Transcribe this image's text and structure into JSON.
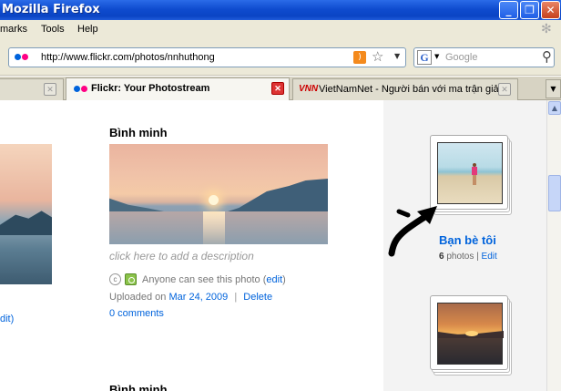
{
  "window": {
    "title": "Mozilla Firefox"
  },
  "menu": {
    "bookmarks": "marks",
    "tools": "Tools",
    "help": "Help"
  },
  "nav": {
    "url": "http://www.flickr.com/photos/nnhuthong",
    "search_placeholder": "Google",
    "search_engine_letter": "G"
  },
  "tabs": [
    {
      "label": ""
    },
    {
      "label": "Flickr: Your Photostream"
    },
    {
      "label": "VietNamNet - Người bán với ma trận giả...",
      "icon_text": "VNN"
    }
  ],
  "left_partial": {
    "link": "dit)"
  },
  "photo": {
    "title": "Bình minh",
    "description_placeholder": "click here to add a description",
    "permission": "Anyone can see this photo",
    "edit": "edit",
    "uploaded_label": "Uploaded on",
    "uploaded_date": "Mar 24, 2009",
    "delete": "Delete",
    "comments": "0 comments"
  },
  "photo2": {
    "title": "Bình minh"
  },
  "set": {
    "title": "Bạn bè tôi",
    "count": "6",
    "count_label": "photos",
    "edit": "Edit"
  },
  "icons": {
    "favicon": "flickr-favicon",
    "rss": "rss-icon",
    "bookmark": "star-icon",
    "search": "magnifier-icon",
    "cc": "creative-commons-icon",
    "privacy": "globe-icon",
    "arrow": "hand-drawn-arrow-icon"
  }
}
